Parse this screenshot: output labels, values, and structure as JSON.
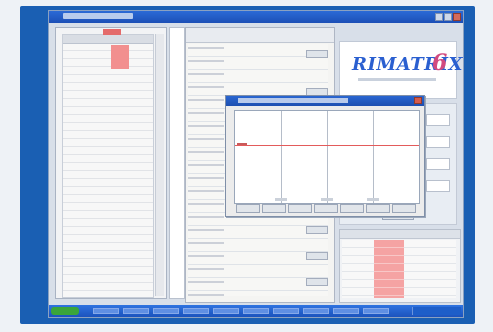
{
  "window": {
    "title": ""
  },
  "brand": {
    "logo_text": "RIMATRIX",
    "logo_suffix": "6"
  },
  "dialog": {
    "title": ""
  },
  "taskbar": {
    "start_label": "",
    "items": [
      "",
      "",
      "",
      "",
      "",
      "",
      "",
      "",
      "",
      ""
    ],
    "tray_text": ""
  }
}
